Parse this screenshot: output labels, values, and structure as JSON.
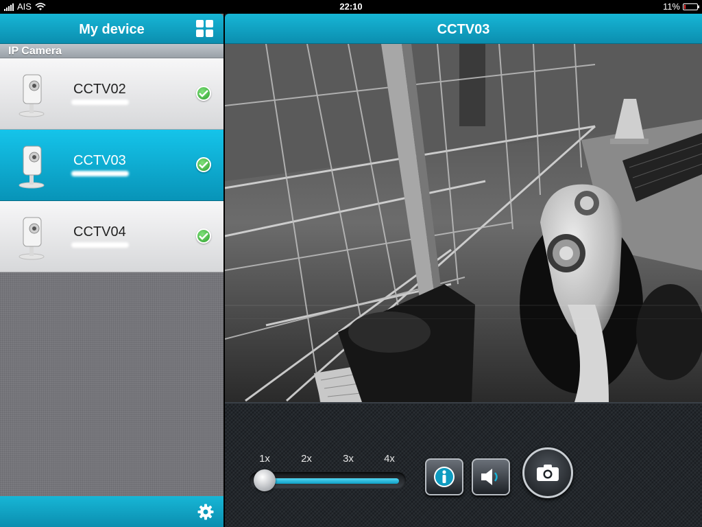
{
  "status_bar": {
    "carrier": "AIS",
    "time": "22:10",
    "battery_text": "11%",
    "battery_level": 0.11
  },
  "left_panel": {
    "title": "My device",
    "section_label": "IP Camera",
    "devices": [
      {
        "name": "CCTV02",
        "selected": false,
        "online": true
      },
      {
        "name": "CCTV03",
        "selected": true,
        "online": true
      },
      {
        "name": "CCTV04",
        "selected": false,
        "online": true
      }
    ]
  },
  "right_panel": {
    "title": "CCTV03",
    "zoom": {
      "labels": [
        "1x",
        "2x",
        "3x",
        "4x"
      ],
      "current_index": 0
    }
  },
  "icons": {
    "layout": "grid-icon",
    "settings": "gear-icon",
    "status": "check-circle-icon",
    "device": "ip-camera-icon",
    "info": "info-icon",
    "audio": "speaker-icon",
    "snapshot": "camera-icon"
  },
  "colors": {
    "accent": "#0fa8cb",
    "selected_row": "#0aa7cf",
    "online": "#3bb33a"
  }
}
